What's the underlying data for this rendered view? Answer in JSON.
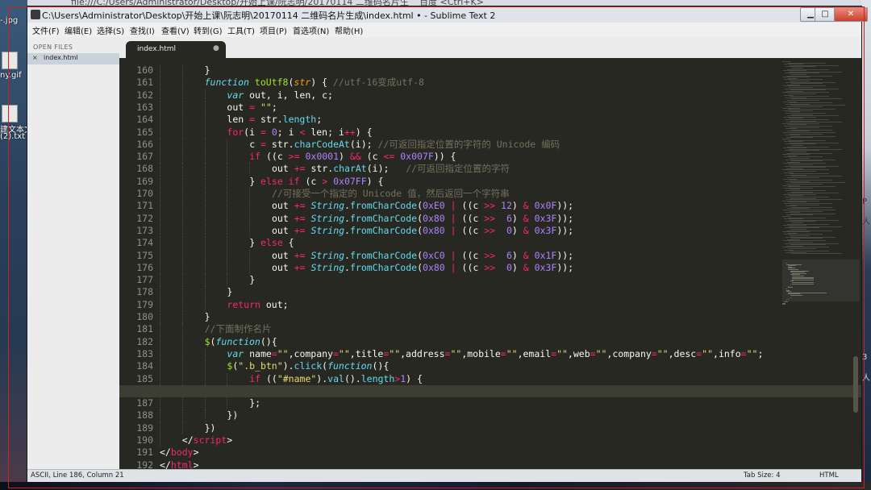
{
  "browser": {
    "address": "file:///C:/Users/Administrator/Desktop/开始上课/阮志明/20170114 二维码名片生",
    "search_hint": "百度 <Ctrl+K>"
  },
  "desktop": {
    "icons": [
      "-.jpg",
      "ny.gif",
      "建文本文",
      "(2).txt"
    ]
  },
  "right_strip": [
    "P",
    "人",
    "3",
    "人"
  ],
  "window": {
    "title": "C:\\Users\\Administrator\\Desktop\\开始上课\\阮志明\\20170114 二维码名片生成\\index.html • - Sublime Text 2",
    "buttons": {
      "minimize": "▁",
      "maximize": "□",
      "close": "✕"
    }
  },
  "menu": [
    "文件(F)",
    "编辑(E)",
    "选择(S)",
    "查找(I)",
    "查看(V)",
    "转到(G)",
    "工具(T)",
    "项目(P)",
    "首选项(N)",
    "帮助(H)"
  ],
  "sidebar": {
    "section_label": "OPEN FILES",
    "file": "index.html",
    "close_glyph": "×"
  },
  "tab": {
    "label": "index.html",
    "dirty_glyph": "●"
  },
  "editor": {
    "current_line": 186,
    "lines": [
      {
        "n": "160",
        "indent": 4,
        "tokens": [
          [
            "p",
            "}"
          ]
        ]
      },
      {
        "n": "161",
        "indent": 4,
        "tokens": [
          [
            "st",
            "function"
          ],
          [
            "p",
            " "
          ],
          [
            "fn",
            "toUtf8"
          ],
          [
            "p",
            "("
          ],
          [
            "arg",
            "str"
          ],
          [
            "p",
            ") { "
          ],
          [
            "cm",
            "//utf-16变成utf-8"
          ]
        ]
      },
      {
        "n": "162",
        "indent": 6,
        "tokens": [
          [
            "st",
            "var"
          ],
          [
            "p",
            " out, i, len, c;"
          ]
        ]
      },
      {
        "n": "163",
        "indent": 6,
        "tokens": [
          [
            "p",
            "out "
          ],
          [
            "op",
            "="
          ],
          [
            "p",
            " "
          ],
          [
            "str",
            "\"\""
          ],
          [
            "p",
            ";"
          ]
        ]
      },
      {
        "n": "164",
        "indent": 6,
        "tokens": [
          [
            "p",
            "len "
          ],
          [
            "op",
            "="
          ],
          [
            "p",
            " str."
          ],
          [
            "prop",
            "length"
          ],
          [
            "p",
            ";"
          ]
        ]
      },
      {
        "n": "165",
        "indent": 6,
        "tokens": [
          [
            "kw",
            "for"
          ],
          [
            "p",
            "(i "
          ],
          [
            "op",
            "="
          ],
          [
            "p",
            " "
          ],
          [
            "num",
            "0"
          ],
          [
            "p",
            "; i "
          ],
          [
            "op",
            "<"
          ],
          [
            "p",
            " len; i"
          ],
          [
            "op",
            "++"
          ],
          [
            "p",
            ") {"
          ]
        ]
      },
      {
        "n": "166",
        "indent": 8,
        "tokens": [
          [
            "p",
            "c "
          ],
          [
            "op",
            "="
          ],
          [
            "p",
            " str."
          ],
          [
            "prop",
            "charCodeAt"
          ],
          [
            "p",
            "(i); "
          ],
          [
            "cm",
            "//可返回指定位置的字符的 Unicode 编码"
          ]
        ]
      },
      {
        "n": "167",
        "indent": 8,
        "tokens": [
          [
            "kw",
            "if"
          ],
          [
            "p",
            " ((c "
          ],
          [
            "op",
            ">="
          ],
          [
            "p",
            " "
          ],
          [
            "num",
            "0x0001"
          ],
          [
            "p",
            ") "
          ],
          [
            "op",
            "&&"
          ],
          [
            "p",
            " (c "
          ],
          [
            "op",
            "<="
          ],
          [
            "p",
            " "
          ],
          [
            "num",
            "0x007F"
          ],
          [
            "p",
            ")) {"
          ]
        ]
      },
      {
        "n": "168",
        "indent": 10,
        "tokens": [
          [
            "p",
            "out "
          ],
          [
            "op",
            "+="
          ],
          [
            "p",
            " str."
          ],
          [
            "prop",
            "charAt"
          ],
          [
            "p",
            "(i);   "
          ],
          [
            "cm",
            "//可返回指定位置的字符"
          ]
        ]
      },
      {
        "n": "169",
        "indent": 8,
        "tokens": [
          [
            "p",
            "} "
          ],
          [
            "kw",
            "else if"
          ],
          [
            "p",
            " (c "
          ],
          [
            "op",
            ">"
          ],
          [
            "p",
            " "
          ],
          [
            "num",
            "0x07FF"
          ],
          [
            "p",
            ") {"
          ]
        ]
      },
      {
        "n": "170",
        "indent": 10,
        "tokens": [
          [
            "cm",
            "//可接受一个指定的 Unicode 值，然后返回一个字符串"
          ]
        ]
      },
      {
        "n": "171",
        "indent": 10,
        "tokens": [
          [
            "p",
            "out "
          ],
          [
            "op",
            "+="
          ],
          [
            "p",
            " "
          ],
          [
            "cls",
            "String"
          ],
          [
            "p",
            "."
          ],
          [
            "prop",
            "fromCharCode"
          ],
          [
            "p",
            "("
          ],
          [
            "num",
            "0xE0"
          ],
          [
            "p",
            " "
          ],
          [
            "op",
            "|"
          ],
          [
            "p",
            " ((c "
          ],
          [
            "op",
            ">>"
          ],
          [
            "p",
            " "
          ],
          [
            "num",
            "12"
          ],
          [
            "p",
            ") "
          ],
          [
            "op",
            "&"
          ],
          [
            "p",
            " "
          ],
          [
            "num",
            "0x0F"
          ],
          [
            "p",
            "));"
          ]
        ]
      },
      {
        "n": "172",
        "indent": 10,
        "tokens": [
          [
            "p",
            "out "
          ],
          [
            "op",
            "+="
          ],
          [
            "p",
            " "
          ],
          [
            "cls",
            "String"
          ],
          [
            "p",
            "."
          ],
          [
            "prop",
            "fromCharCode"
          ],
          [
            "p",
            "("
          ],
          [
            "num",
            "0x80"
          ],
          [
            "p",
            " "
          ],
          [
            "op",
            "|"
          ],
          [
            "p",
            " ((c "
          ],
          [
            "op",
            ">>"
          ],
          [
            "p",
            "  "
          ],
          [
            "num",
            "6"
          ],
          [
            "p",
            ") "
          ],
          [
            "op",
            "&"
          ],
          [
            "p",
            " "
          ],
          [
            "num",
            "0x3F"
          ],
          [
            "p",
            "));"
          ]
        ]
      },
      {
        "n": "173",
        "indent": 10,
        "tokens": [
          [
            "p",
            "out "
          ],
          [
            "op",
            "+="
          ],
          [
            "p",
            " "
          ],
          [
            "cls",
            "String"
          ],
          [
            "p",
            "."
          ],
          [
            "prop",
            "fromCharCode"
          ],
          [
            "p",
            "("
          ],
          [
            "num",
            "0x80"
          ],
          [
            "p",
            " "
          ],
          [
            "op",
            "|"
          ],
          [
            "p",
            " ((c "
          ],
          [
            "op",
            ">>"
          ],
          [
            "p",
            "  "
          ],
          [
            "num",
            "0"
          ],
          [
            "p",
            ") "
          ],
          [
            "op",
            "&"
          ],
          [
            "p",
            " "
          ],
          [
            "num",
            "0x3F"
          ],
          [
            "p",
            "));"
          ]
        ]
      },
      {
        "n": "174",
        "indent": 8,
        "tokens": [
          [
            "p",
            "} "
          ],
          [
            "kw",
            "else"
          ],
          [
            "p",
            " {"
          ]
        ]
      },
      {
        "n": "175",
        "indent": 10,
        "tokens": [
          [
            "p",
            "out "
          ],
          [
            "op",
            "+="
          ],
          [
            "p",
            " "
          ],
          [
            "cls",
            "String"
          ],
          [
            "p",
            "."
          ],
          [
            "prop",
            "fromCharCode"
          ],
          [
            "p",
            "("
          ],
          [
            "num",
            "0xC0"
          ],
          [
            "p",
            " "
          ],
          [
            "op",
            "|"
          ],
          [
            "p",
            " ((c "
          ],
          [
            "op",
            ">>"
          ],
          [
            "p",
            "  "
          ],
          [
            "num",
            "6"
          ],
          [
            "p",
            ") "
          ],
          [
            "op",
            "&"
          ],
          [
            "p",
            " "
          ],
          [
            "num",
            "0x1F"
          ],
          [
            "p",
            "));"
          ]
        ]
      },
      {
        "n": "176",
        "indent": 10,
        "tokens": [
          [
            "p",
            "out "
          ],
          [
            "op",
            "+="
          ],
          [
            "p",
            " "
          ],
          [
            "cls",
            "String"
          ],
          [
            "p",
            "."
          ],
          [
            "prop",
            "fromCharCode"
          ],
          [
            "p",
            "("
          ],
          [
            "num",
            "0x80"
          ],
          [
            "p",
            " "
          ],
          [
            "op",
            "|"
          ],
          [
            "p",
            " ((c "
          ],
          [
            "op",
            ">>"
          ],
          [
            "p",
            "  "
          ],
          [
            "num",
            "0"
          ],
          [
            "p",
            ") "
          ],
          [
            "op",
            "&"
          ],
          [
            "p",
            " "
          ],
          [
            "num",
            "0x3F"
          ],
          [
            "p",
            "));"
          ]
        ]
      },
      {
        "n": "177",
        "indent": 8,
        "tokens": [
          [
            "p",
            "}"
          ]
        ]
      },
      {
        "n": "178",
        "indent": 6,
        "tokens": [
          [
            "p",
            "}"
          ]
        ]
      },
      {
        "n": "179",
        "indent": 6,
        "tokens": [
          [
            "kw",
            "return"
          ],
          [
            "p",
            " out;"
          ]
        ]
      },
      {
        "n": "180",
        "indent": 4,
        "tokens": [
          [
            "p",
            "}"
          ]
        ]
      },
      {
        "n": "181",
        "indent": 4,
        "tokens": [
          [
            "cm",
            "//下面制作名片"
          ]
        ]
      },
      {
        "n": "182",
        "indent": 4,
        "tokens": [
          [
            "fn",
            "$"
          ],
          [
            "p",
            "("
          ],
          [
            "st",
            "function"
          ],
          [
            "p",
            "(){"
          ]
        ]
      },
      {
        "n": "183",
        "indent": 6,
        "tokens": [
          [
            "st",
            "var"
          ],
          [
            "p",
            " name"
          ],
          [
            "op",
            "="
          ],
          [
            "str",
            "\"\""
          ],
          [
            "p",
            ",company"
          ],
          [
            "op",
            "="
          ],
          [
            "str",
            "\"\""
          ],
          [
            "p",
            ",title"
          ],
          [
            "op",
            "="
          ],
          [
            "str",
            "\"\""
          ],
          [
            "p",
            ",address"
          ],
          [
            "op",
            "="
          ],
          [
            "str",
            "\"\""
          ],
          [
            "p",
            ",mobile"
          ],
          [
            "op",
            "="
          ],
          [
            "str",
            "\"\""
          ],
          [
            "p",
            ",email"
          ],
          [
            "op",
            "="
          ],
          [
            "str",
            "\"\""
          ],
          [
            "p",
            ",web"
          ],
          [
            "op",
            "="
          ],
          [
            "str",
            "\"\""
          ],
          [
            "p",
            ",company"
          ],
          [
            "op",
            "="
          ],
          [
            "str",
            "\"\""
          ],
          [
            "p",
            ",desc"
          ],
          [
            "op",
            "="
          ],
          [
            "str",
            "\"\""
          ],
          [
            "p",
            ",info"
          ],
          [
            "op",
            "="
          ],
          [
            "str",
            "\"\""
          ],
          [
            "p",
            ";"
          ]
        ]
      },
      {
        "n": "184",
        "indent": 6,
        "tokens": [
          [
            "fn",
            "$"
          ],
          [
            "p",
            "("
          ],
          [
            "str",
            "\".b_btn\""
          ],
          [
            "p",
            ")."
          ],
          [
            "prop",
            "click"
          ],
          [
            "p",
            "("
          ],
          [
            "st",
            "function"
          ],
          [
            "p",
            "(){"
          ]
        ]
      },
      {
        "n": "185",
        "indent": 8,
        "tokens": [
          [
            "kw",
            "if"
          ],
          [
            "p",
            " (("
          ],
          [
            "str",
            "\"#name\""
          ],
          [
            "p",
            ")."
          ],
          [
            "prop",
            "val"
          ],
          [
            "p",
            "()."
          ],
          [
            "prop",
            "length"
          ],
          [
            "op",
            ">"
          ],
          [
            "num",
            "1"
          ],
          [
            "p",
            ") {"
          ]
        ]
      },
      {
        "n": "186",
        "indent": 0,
        "tokens": []
      },
      {
        "n": "187",
        "indent": 8,
        "tokens": [
          [
            "p",
            "};"
          ]
        ]
      },
      {
        "n": "188",
        "indent": 6,
        "tokens": [
          [
            "p",
            "})"
          ]
        ]
      },
      {
        "n": "189",
        "indent": 4,
        "tokens": [
          [
            "p",
            "})"
          ]
        ]
      },
      {
        "n": "190",
        "indent": 2,
        "tokens": [
          [
            "p",
            "</"
          ],
          [
            "kw",
            "script"
          ],
          [
            "p",
            ">"
          ]
        ]
      },
      {
        "n": "191",
        "indent": 0,
        "tokens": [
          [
            "p",
            "</"
          ],
          [
            "kw",
            "body"
          ],
          [
            "p",
            ">"
          ]
        ]
      },
      {
        "n": "192",
        "indent": 0,
        "tokens": [
          [
            "p",
            "</"
          ],
          [
            "kw",
            "html"
          ],
          [
            "p",
            ">"
          ]
        ]
      }
    ]
  },
  "status": {
    "left": "ASCII, Line 186, Column 21",
    "tab_size": "Tab Size: 4",
    "syntax": "HTML"
  },
  "colors": {
    "bg": "#272822",
    "keyword": "#f92672",
    "storage": "#66d9ef",
    "function": "#a6e22e",
    "number": "#ae81ff",
    "string": "#e6db74",
    "comment": "#75715e"
  }
}
